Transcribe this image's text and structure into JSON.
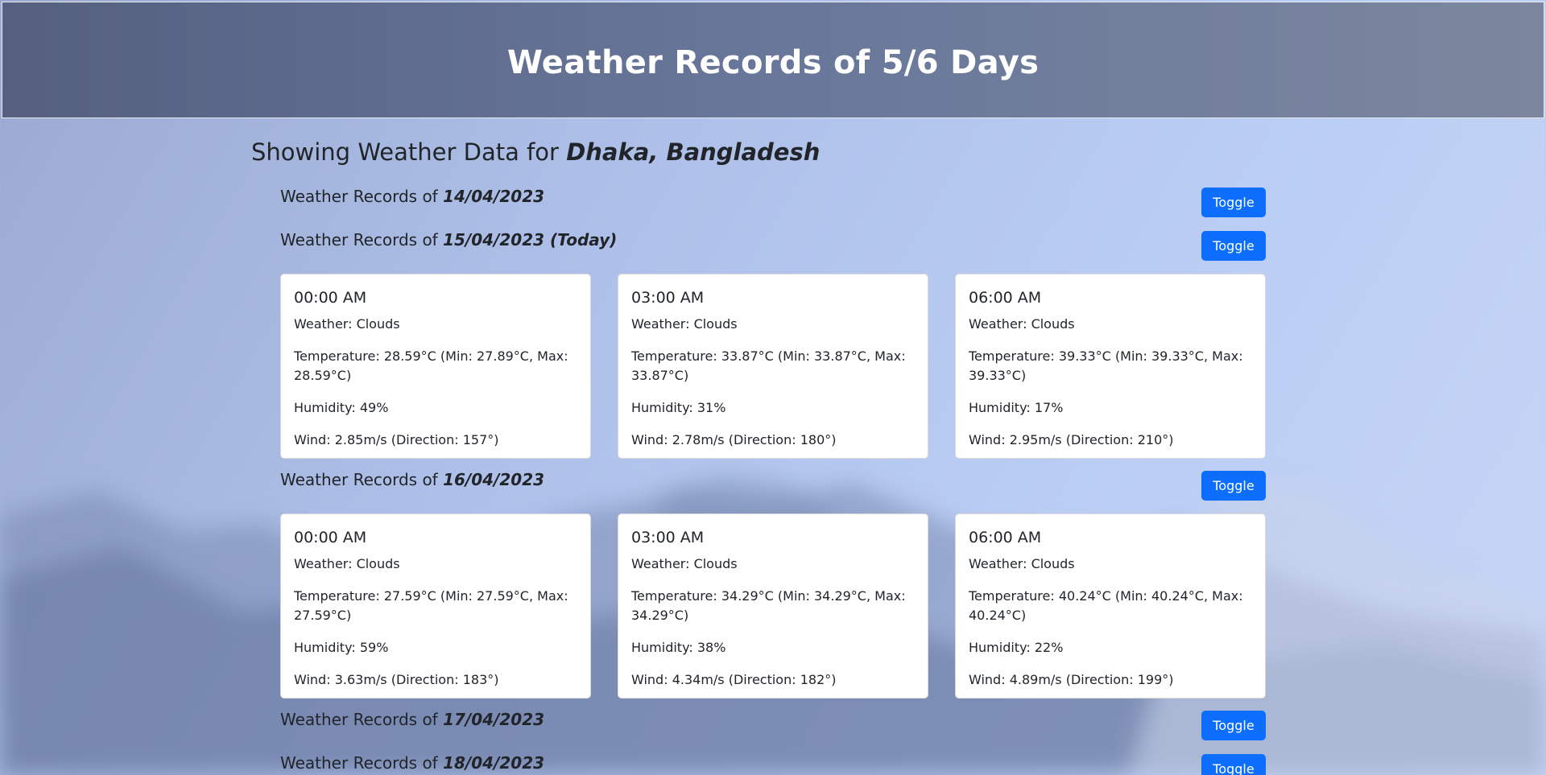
{
  "header": {
    "title": "Weather Records of 5/6 Days"
  },
  "location": {
    "prefix": "Showing Weather Data for",
    "name": "Dhaka, Bangladesh"
  },
  "toggle_label": "Toggle",
  "record_prefix": "Weather Records of",
  "days": [
    {
      "date": "14/04/2023",
      "cards": []
    },
    {
      "date": "15/04/2023 (Today)",
      "cards": [
        {
          "time": "00:00 AM",
          "weather": "Weather: Clouds",
          "temperature": "Temperature: 28.59°C (Min: 27.89°C, Max: 28.59°C)",
          "humidity": "Humidity: 49%",
          "wind": "Wind: 2.85m/s (Direction: 157°)"
        },
        {
          "time": "03:00 AM",
          "weather": "Weather: Clouds",
          "temperature": "Temperature: 33.87°C (Min: 33.87°C, Max: 33.87°C)",
          "humidity": "Humidity: 31%",
          "wind": "Wind: 2.78m/s (Direction: 180°)"
        },
        {
          "time": "06:00 AM",
          "weather": "Weather: Clouds",
          "temperature": "Temperature: 39.33°C (Min: 39.33°C, Max: 39.33°C)",
          "humidity": "Humidity: 17%",
          "wind": "Wind: 2.95m/s (Direction: 210°)"
        }
      ]
    },
    {
      "date": "16/04/2023",
      "cards": [
        {
          "time": "00:00 AM",
          "weather": "Weather: Clouds",
          "temperature": "Temperature: 27.59°C (Min: 27.59°C, Max: 27.59°C)",
          "humidity": "Humidity: 59%",
          "wind": "Wind: 3.63m/s (Direction: 183°)"
        },
        {
          "time": "03:00 AM",
          "weather": "Weather: Clouds",
          "temperature": "Temperature: 34.29°C (Min: 34.29°C, Max: 34.29°C)",
          "humidity": "Humidity: 38%",
          "wind": "Wind: 4.34m/s (Direction: 182°)"
        },
        {
          "time": "06:00 AM",
          "weather": "Weather: Clouds",
          "temperature": "Temperature: 40.24°C (Min: 40.24°C, Max: 40.24°C)",
          "humidity": "Humidity: 22%",
          "wind": "Wind: 4.89m/s (Direction: 199°)"
        }
      ]
    },
    {
      "date": "17/04/2023",
      "cards": []
    },
    {
      "date": "18/04/2023",
      "cards": []
    }
  ],
  "colors": {
    "button": "#0d6efd",
    "header_bg": "#5c6888"
  }
}
